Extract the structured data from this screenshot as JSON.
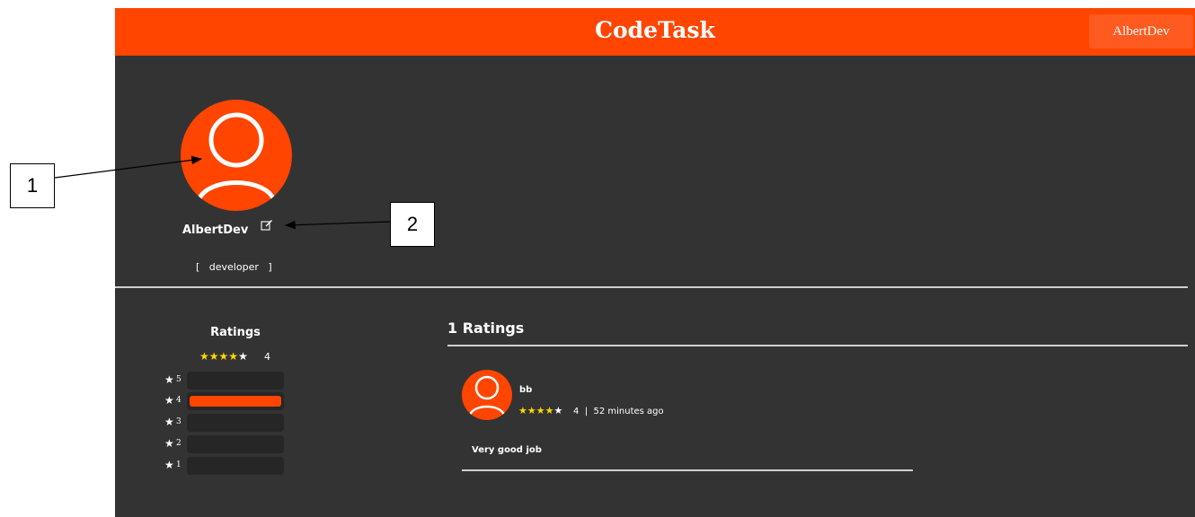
{
  "header": {
    "brand": "CodeTask",
    "user_button_label": "AlbertDev",
    "brand_color": "#ff4500"
  },
  "profile": {
    "username": "AlbertDev",
    "role": "[   developer   ]",
    "avatar_icon": "user-avatar-icon",
    "edit_icon": "edit-icon"
  },
  "rating_summary": {
    "title": "Ratings",
    "average": "4",
    "average_stars": 4,
    "distribution": [
      {
        "level": "5",
        "fraction": 0
      },
      {
        "level": "4",
        "fraction": 1
      },
      {
        "level": "3",
        "fraction": 0
      },
      {
        "level": "2",
        "fraction": 0
      },
      {
        "level": "1",
        "fraction": 0
      }
    ]
  },
  "reviews": {
    "title": "1 Ratings",
    "items": [
      {
        "reviewer": "bb",
        "stars": 4,
        "rating": "4",
        "time": "52 minutes ago",
        "comment": "Very good job"
      }
    ]
  },
  "callouts": [
    {
      "label": "1"
    },
    {
      "label": "2"
    }
  ]
}
